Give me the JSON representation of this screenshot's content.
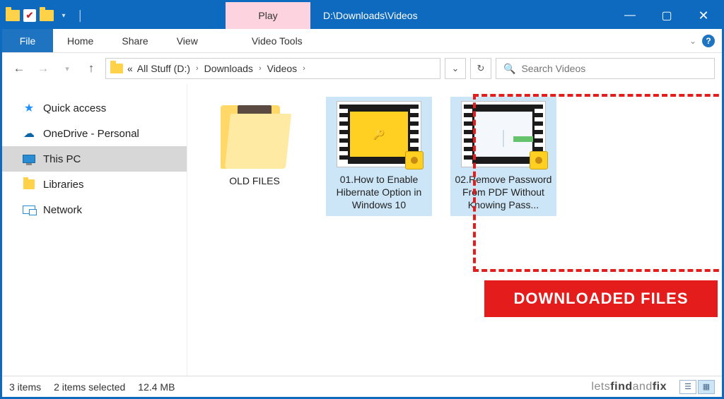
{
  "titlebar": {
    "play_tab": "Play",
    "path_title": "D:\\Downloads\\Videos"
  },
  "ribbon": {
    "file": "File",
    "tabs": [
      "Home",
      "Share",
      "View"
    ],
    "tools": "Video Tools"
  },
  "address": {
    "prefix": "«",
    "crumbs": [
      "All Stuff (D:)",
      "Downloads",
      "Videos"
    ]
  },
  "search": {
    "placeholder": "Search Videos"
  },
  "sidebar": {
    "items": [
      {
        "label": "Quick access"
      },
      {
        "label": "OneDrive - Personal"
      },
      {
        "label": "This PC"
      },
      {
        "label": "Libraries"
      },
      {
        "label": "Network"
      }
    ]
  },
  "content": {
    "items": [
      {
        "name": "OLD FILES",
        "kind": "folder",
        "selected": false
      },
      {
        "name": "01.How to Enable Hibernate Option in Windows 10",
        "kind": "video",
        "screen": "yellow",
        "selected": true
      },
      {
        "name": "02.Remove Password From PDF Without Knowing Pass...",
        "kind": "video",
        "screen": "white",
        "selected": true
      }
    ]
  },
  "annotation": {
    "banner": "DOWNLOADED FILES"
  },
  "status": {
    "count": "3 items",
    "selection": "2 items selected",
    "size": "12.4 MB",
    "brand_prefix": "lets",
    "brand_mid1": "find",
    "brand_mid2": "and",
    "brand_end": "fix"
  }
}
